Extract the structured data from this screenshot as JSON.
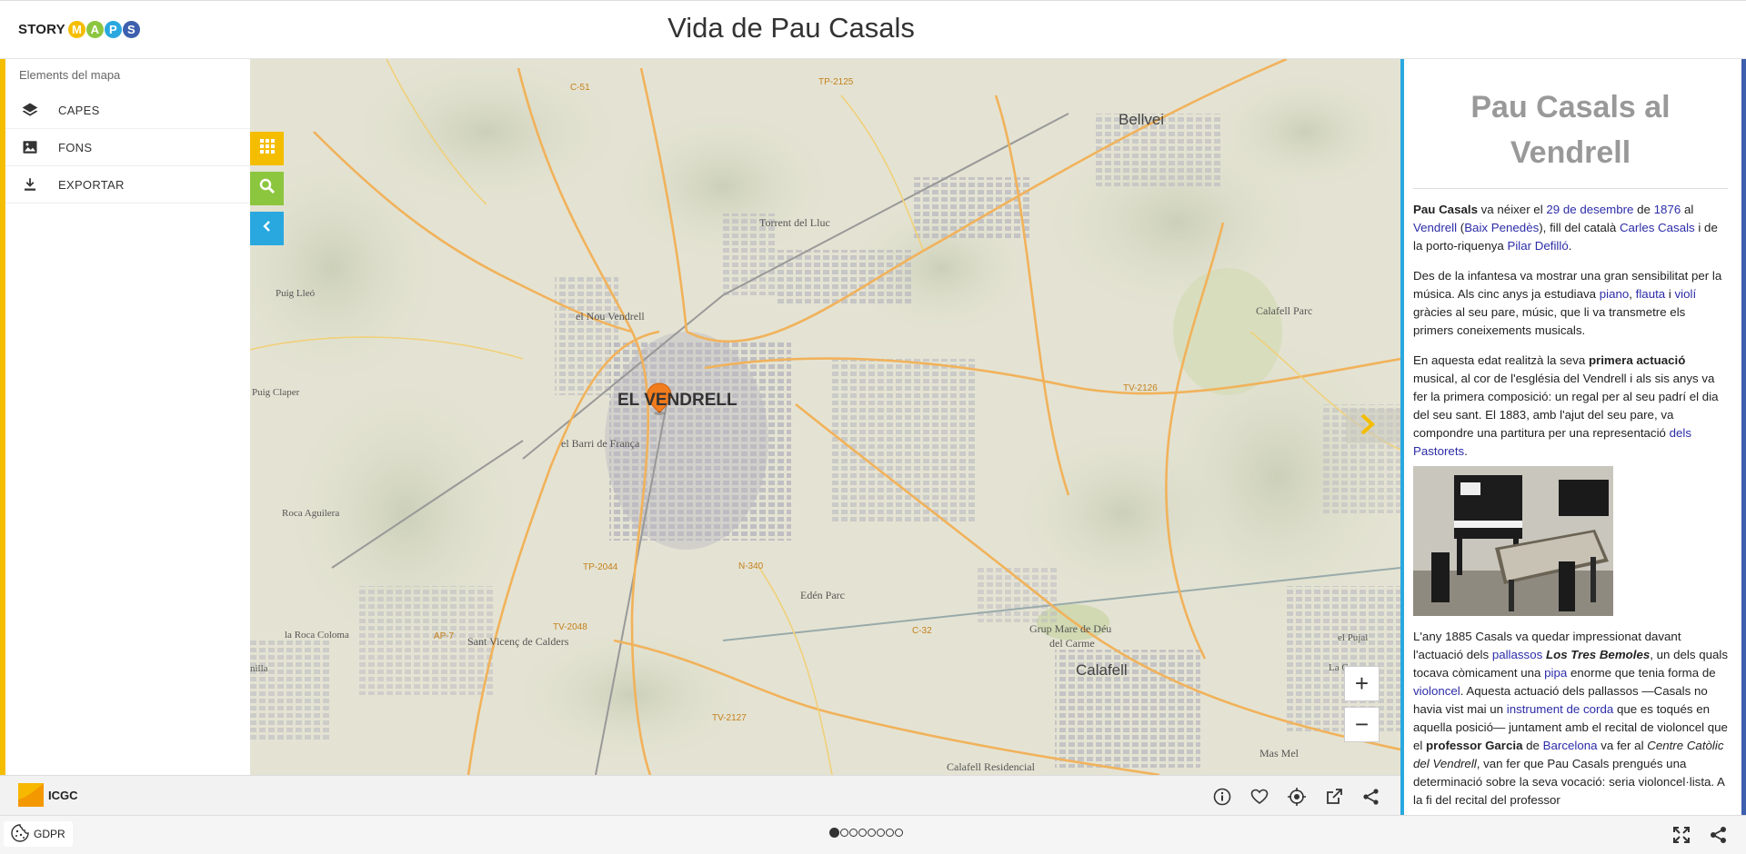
{
  "header": {
    "logo_text": "STORY",
    "logo_letters": [
      {
        "letter": "M",
        "color": "#f5bd00"
      },
      {
        "letter": "A",
        "color": "#8cc63f"
      },
      {
        "letter": "P",
        "color": "#29a8e0"
      },
      {
        "letter": "S",
        "color": "#3d5fae"
      }
    ],
    "title": "Vida de Pau Casals"
  },
  "sidebar": {
    "title": "Elements del mapa",
    "items": [
      {
        "label": "CAPES",
        "icon": "layers-icon"
      },
      {
        "label": "FONS",
        "icon": "image-icon"
      },
      {
        "label": "EXPORTAR",
        "icon": "download-icon"
      }
    ]
  },
  "map": {
    "tools": [
      "grid-icon",
      "search-icon",
      "chevron-left-icon"
    ],
    "places": {
      "bellvei": "Bellvei",
      "torrent": "Torrent del Lluc",
      "puig_lleo": "Puig Lleó",
      "nou_vendrell": "el Nou Vendrell",
      "calafell_parc": "Calafell Parc",
      "puig_claper": "Puig Claper",
      "el_vendrell": "EL VENDRELL",
      "barri_franca": "el Barri de França",
      "roca_aguilera": "Roca Aguilera",
      "eden_parc": "Edén Parc",
      "grup_mare_deu": "Grup Mare de Déu",
      "del_carme": "del Carme",
      "la_roca_coloma": "la Roca Coloma",
      "sant_vicenc": "Sant Vicenç de Calders",
      "calafell": "Calafell",
      "el_pujal": "el Pujal",
      "la_cas": "La Cas",
      "nilla": "nilla",
      "mas_mel": "Mas Mel",
      "calafell_residencial": "Calafell Residencial"
    },
    "roads": {
      "c51": "C-51",
      "tp2125": "TP-2125",
      "tv2126": "TV-2126",
      "tp2044": "TP-2044",
      "n340": "N-340",
      "tv2048": "TV-2048",
      "ap7": "AP-7",
      "c32": "C-32",
      "tv2127": "TV-2127"
    },
    "zoom_in": "+",
    "zoom_out": "−"
  },
  "map_footer": {
    "logo_text": "ICGC",
    "icons": [
      "info-icon",
      "heart-icon",
      "locate-icon",
      "external-link-icon",
      "share-icon"
    ]
  },
  "panel": {
    "title": "Pau Casals al Vendrell",
    "p1": {
      "name": "Pau Casals",
      "t1": " va néixer el ",
      "date": "29 de desembre",
      "t2": " de ",
      "year": "1876",
      "t3": " al ",
      "town": "Vendrell",
      "t4": " (",
      "region": "Baix Penedès",
      "t5": "), fill del català ",
      "father": "Carles Casals",
      "t6": " i de la porto-riquenya ",
      "mother": "Pilar Defilló",
      "t7": "."
    },
    "p2": {
      "t1": "Des de la infantesa va mostrar una gran sensibilitat per la música. Als cinc anys ja estudiava ",
      "piano": "piano",
      "t2": ", ",
      "flauta": "flauta",
      "t3": " i ",
      "violi": "violí",
      "t4": " gràcies al seu pare, músic, que li va transmetre els primers coneixements musicals."
    },
    "p3": {
      "t1": "En aquesta edat realitzà la seva ",
      "bold": "primera actuació",
      "t2": " musical, al cor de l'església del Vendrell i als sis anys va fer la primera composició: un regal per al seu padrí el dia del seu sant. El 1883, amb l'ajut del seu pare, va compondre una partitura per una representació ",
      "link": "dels Pastorets",
      "t3": "."
    },
    "p4": {
      "t1": "L'any 1885 Casals va quedar impressionat davant l'actuació dels ",
      "pallassos": "pallassos",
      "t2": " ",
      "bemoles": "Los Tres Bemoles",
      "t3": ", un dels quals tocava còmicament una ",
      "pipa": "pipa",
      "t4": " enorme que tenia forma de ",
      "violoncel": "violoncel",
      "t5": ". Aquesta actuació dels pallassos —Casals no havia vist mai un ",
      "instrument": "instrument de corda",
      "t6": " que es toqués en aquella posició— juntament amb el recital de violoncel que el ",
      "professor": "professor Garcia",
      "t7": " de ",
      "barcelona": "Barcelona",
      "t8": " va fer al ",
      "centre": "Centre Catòlic del Vendrell",
      "t9": ", van fer que Pau Casals prengués una determinació sobre la seva vocació: seria violoncel·lista. A la fi del recital del professor"
    }
  },
  "bottom": {
    "gdpr": "GDPR",
    "dots_total": 8,
    "active_dot": 0,
    "icons": [
      "fullscreen-icon",
      "share-icon"
    ]
  }
}
